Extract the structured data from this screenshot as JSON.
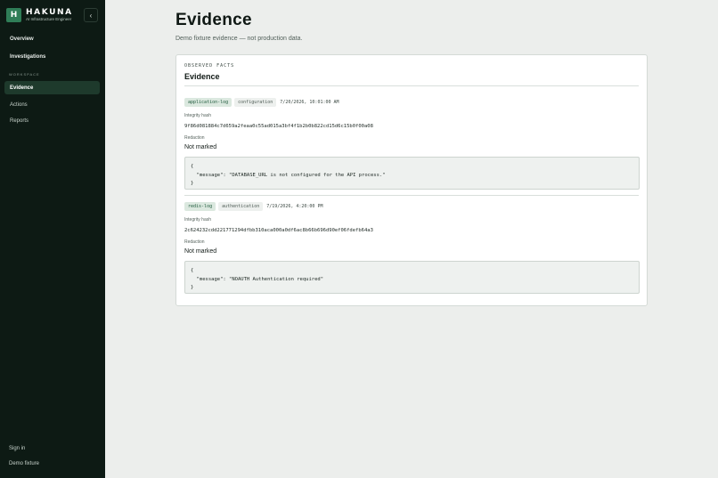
{
  "brand": {
    "mark": "H",
    "name": "HAKUNA",
    "subtitle": "AI Infrastructure Engineer",
    "collapse_icon": "chevron-left-icon"
  },
  "nav": {
    "top_items": [
      {
        "label": "Overview"
      },
      {
        "label": "Investigations"
      }
    ],
    "section_label": "WORKSPACE",
    "workspace_items": [
      {
        "label": "Evidence",
        "active": true
      },
      {
        "label": "Actions"
      },
      {
        "label": "Reports"
      }
    ],
    "bottom_items": [
      {
        "label": "Sign in"
      },
      {
        "label": "Demo fixture"
      }
    ]
  },
  "page": {
    "title": "Evidence",
    "subtitle": "Demo fixture evidence — not production data."
  },
  "card": {
    "eyebrow": "OBSERVED FACTS",
    "title": "Evidence",
    "items": [
      {
        "source": "application-log",
        "category": "configuration",
        "timestamp": "7/20/2026, 10:01:00 AM",
        "hash_label": "Integrity hash",
        "hash": "9f86d081884c7d659a2feaa0c55ad015a3bf4f1b2b0b822cd15d6c15b0f00a08",
        "redaction_label": "Redaction",
        "redaction": "Not marked",
        "payload": "{\n  \"message\": \"DATABASE_URL is not configured for the API process.\"\n}"
      },
      {
        "source": "redis-log",
        "category": "authentication",
        "timestamp": "7/19/2026, 4:20:00 PM",
        "hash_label": "Integrity hash",
        "hash": "2c624232cdd221771294dfbb310aca000a0df6ac8b66b696d90ef06fdefb64a3",
        "redaction_label": "Redaction",
        "redaction": "Not marked",
        "payload": "{\n  \"message\": \"NOAUTH Authentication required\"\n}"
      }
    ]
  },
  "colors": {
    "sidebar": "#0d1a14",
    "accent": "#2f7d57",
    "active_nav": "#1e3a2c",
    "page_bg": "#eceeec"
  }
}
